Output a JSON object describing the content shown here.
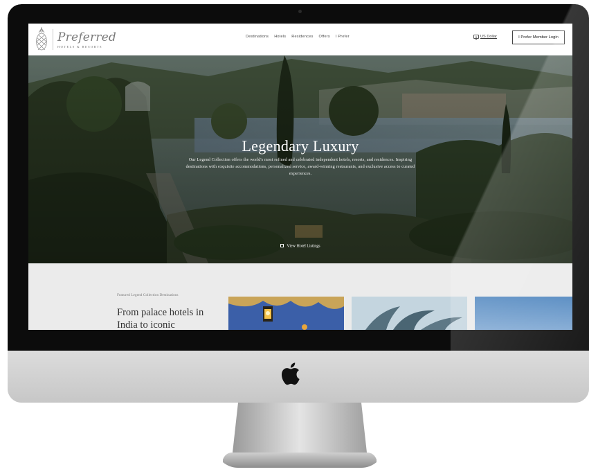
{
  "brand": {
    "script_name": "Preferred",
    "subtitle": "HOTELS & RESORTS"
  },
  "nav": {
    "items": [
      {
        "label": "Destinations"
      },
      {
        "label": "Hotels"
      },
      {
        "label": "Residences"
      },
      {
        "label": "Offers"
      },
      {
        "label": "I Prefer"
      }
    ],
    "currency_label": "US Dollar",
    "login_label": "I Prefer Member Login"
  },
  "hero": {
    "title": "Legendary Luxury",
    "description": "Our Legend Collection offers the world's most refined and celebrated independent hotels, resorts, and residences. Inspiring destinations with exquisite accommodations, personalized service, award-winning restaurants, and exclusive access to curated experiences.",
    "cta_label": "View Hotel Listings"
  },
  "featured": {
    "label": "Featured Legend Collection Destinations",
    "heading": "From palace hotels in India to iconic"
  },
  "colors": {
    "bezel": "#0c0c0c",
    "aluminum": "#d0d0d0",
    "section_bg": "#ebebeb",
    "hero_foliage": "#2f3a2b"
  }
}
